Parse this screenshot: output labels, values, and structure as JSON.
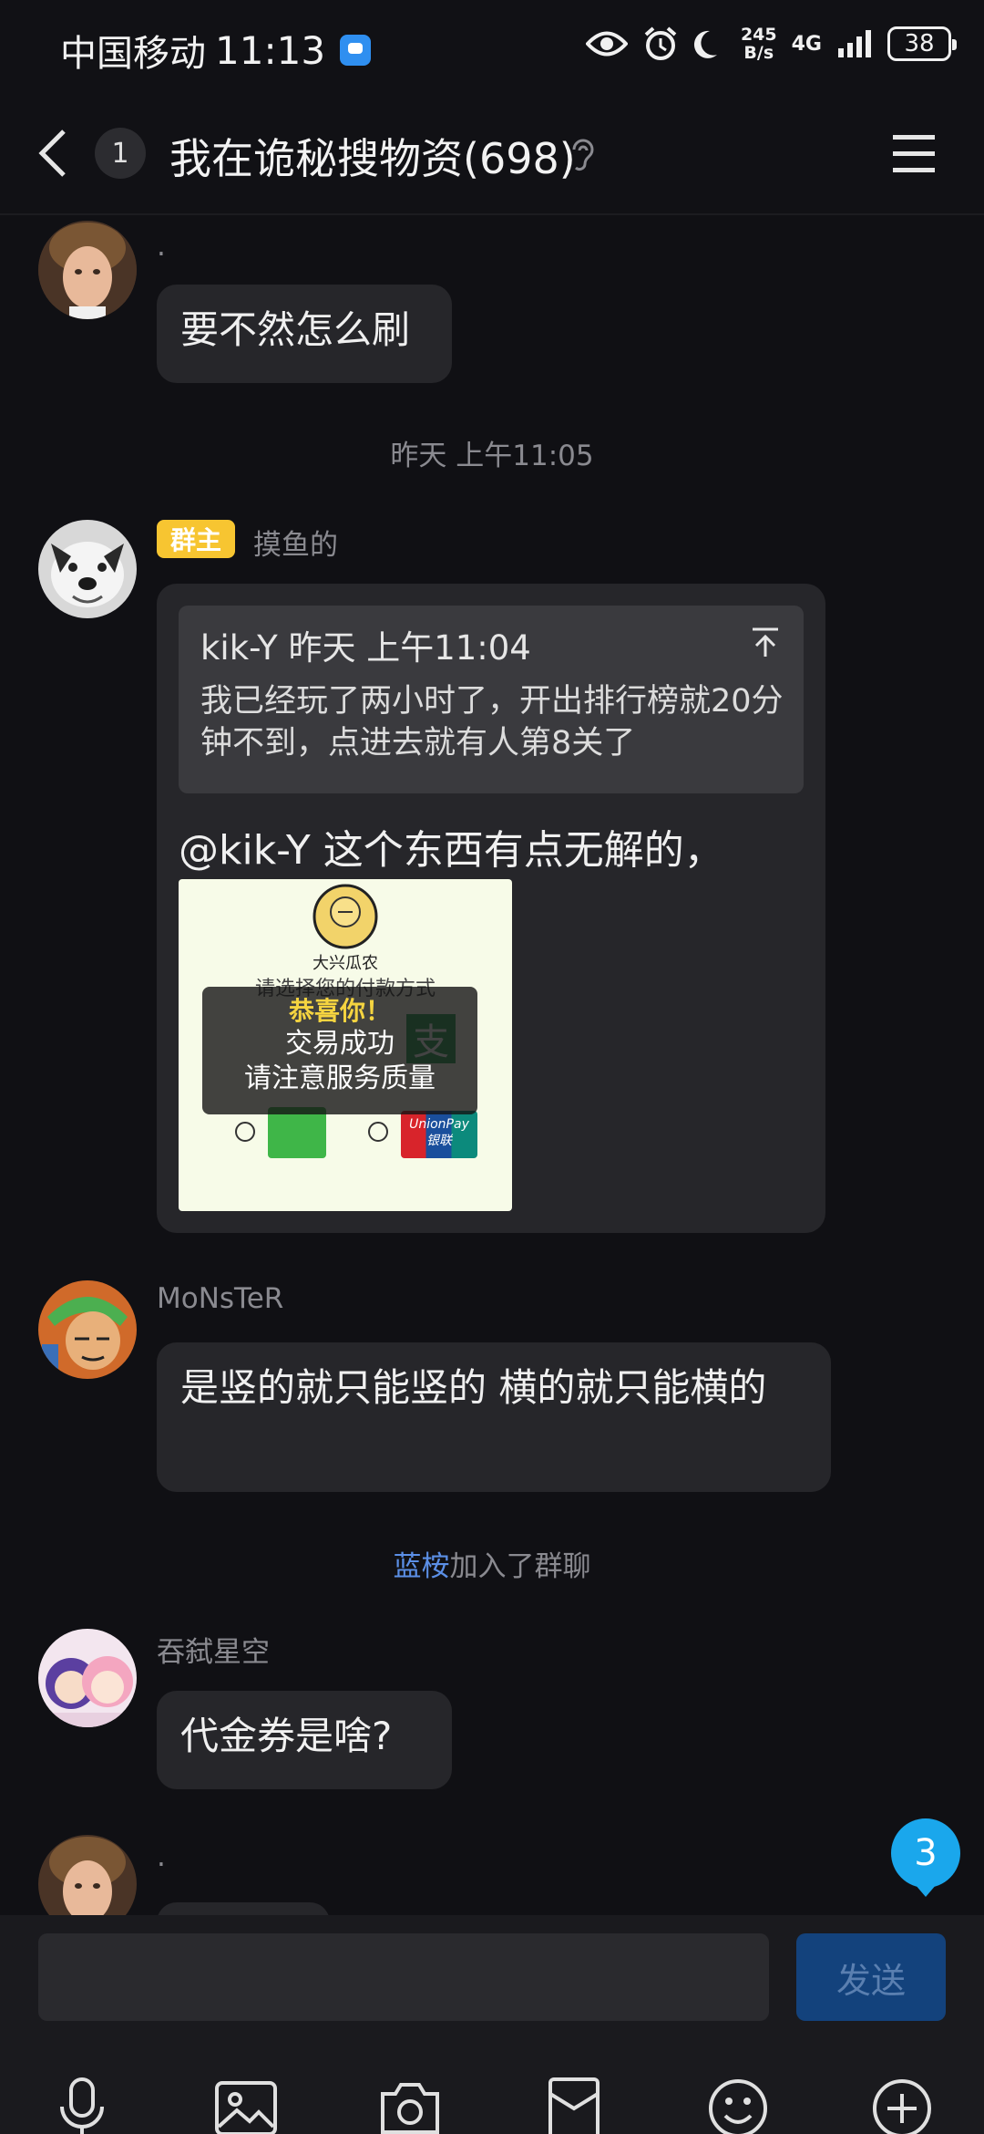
{
  "status_bar": {
    "carrier": "中国移动",
    "time": "11:13",
    "speed_value": "245",
    "speed_unit": "B/s",
    "network": "4G",
    "battery": "38"
  },
  "header": {
    "unread_count": "1",
    "title": "我在诡秘搜物资(698)"
  },
  "messages": [
    {
      "nick": ".",
      "text": "要不然怎么刷"
    },
    {
      "time": "昨天 上午11:05"
    },
    {
      "badge": "群主",
      "nick": "摸鱼的",
      "quote_head": "kik-Y 昨天 上午11:04",
      "quote_body": "我已经玩了两小时了，开出排行榜就20分钟不到，点进去就有人第8关了",
      "text": "@kik-Y  这个东西有点无解的，",
      "image": {
        "shop_name": "大兴瓜农",
        "prompt": "请选择您的付款方式",
        "toast_line1": "恭喜你！",
        "toast_line2": "交易成功",
        "toast_line3": "请注意服务质量",
        "alipay_char": "支",
        "unionpay_en": "UnionPay",
        "unionpay_cn": "银联"
      }
    },
    {
      "nick": "MoNsTeR",
      "text": "是竖的就只能竖的  横的就只能横的"
    },
    {
      "system_link": "蓝桉",
      "system_text": "加入了群聊"
    },
    {
      "nick": "吞弑星空",
      "text": "代金券是啥?"
    },
    {
      "nick": "."
    }
  ],
  "new_message_badge": "3",
  "input": {
    "send_label": "发送"
  },
  "toolbar_icons": [
    "microphone-icon",
    "image-icon",
    "camera-icon",
    "red-packet-icon",
    "emoji-icon",
    "plus-icon"
  ]
}
